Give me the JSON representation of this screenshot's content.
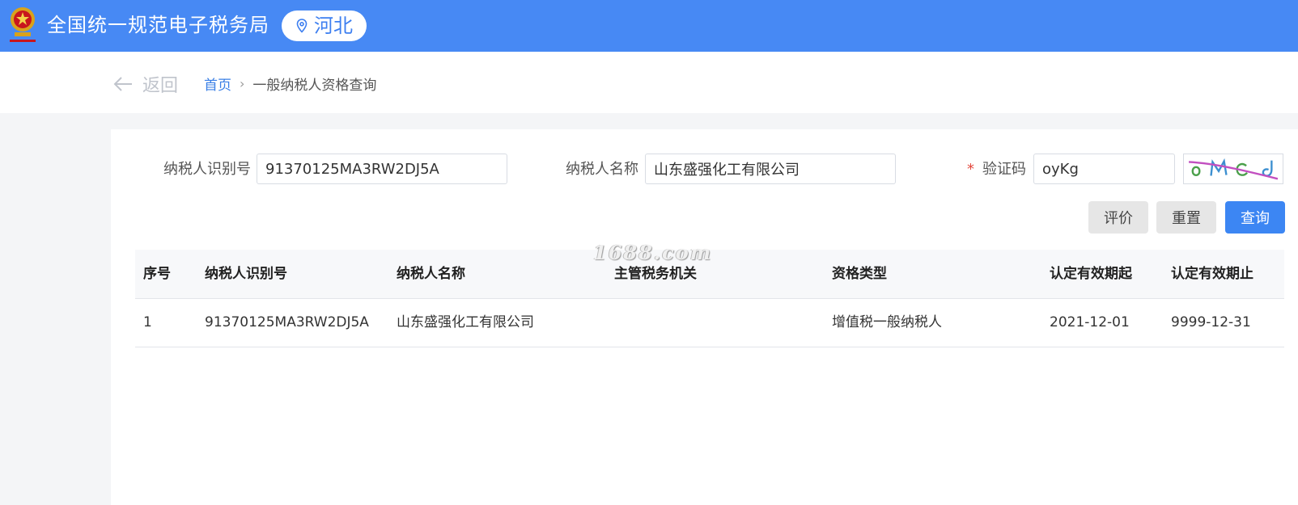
{
  "header": {
    "site_title": "全国统一规范电子税务局",
    "region": "河北",
    "emblem_icon": "national-tax-emblem-icon",
    "region_icon": "location-pin-icon"
  },
  "nav": {
    "back_label": "返回",
    "breadcrumb": {
      "home": "首页",
      "separator": "›",
      "current": "一般纳税人资格查询"
    }
  },
  "form": {
    "taxpayer_id": {
      "label": "纳税人识别号",
      "value": "91370125MA3RW2DJ5A"
    },
    "taxpayer_name": {
      "label": "纳税人名称",
      "value": "山东盛强化工有限公司"
    },
    "captcha": {
      "required_mark": "*",
      "label": "验证码",
      "value": "oyKg"
    }
  },
  "buttons": {
    "evaluate": "评价",
    "reset": "重置",
    "query": "查询"
  },
  "table": {
    "columns": [
      "序号",
      "纳税人识别号",
      "纳税人名称",
      "主管税务机关",
      "资格类型",
      "认定有效期起",
      "认定有效期止"
    ],
    "rows": [
      [
        "1",
        "91370125MA3RW2DJ5A",
        "山东盛强化工有限公司",
        "",
        "增值税一般纳税人",
        "2021-12-01",
        "9999-12-31"
      ]
    ]
  },
  "watermark": "1688.com",
  "colors": {
    "header_bg": "#4789f4",
    "primary_button": "#3c86f3",
    "link": "#3a7fe6",
    "required": "#e3483d"
  }
}
